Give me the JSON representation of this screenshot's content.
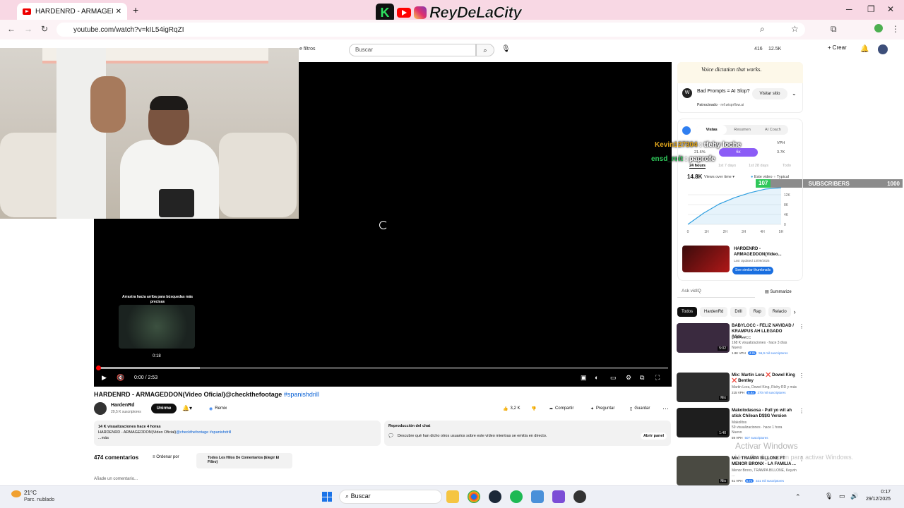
{
  "browser": {
    "tab_title": "HARDENRD - ARMAGEDDON(Vi",
    "url": "youtube.com/watch?v=kIL54igRqZI"
  },
  "overlay": {
    "k_letter": "K",
    "brand": "ReyDeLaCity",
    "chat": [
      {
        "user": "Kevin127304",
        "message": ": tfehy loche"
      },
      {
        "user": "ensd_roit",
        "message": ": paprofe"
      }
    ],
    "subs_label": "SUBSCRIBERS",
    "subs_count": "107",
    "subs_goal": "1000"
  },
  "youtube_header": {
    "filters_label": "e filtros",
    "search_placeholder": "Buscar",
    "stat_a": "416",
    "stat_b": "12.5K",
    "create_label": "Crear"
  },
  "player": {
    "hint": "Arrastra hacia arriba para búsquedas más precisas",
    "preview_time": "0:18",
    "current_time": "0:00 / 2:53",
    "progress_played": 0.003,
    "progress_buffered": 0.18
  },
  "video": {
    "title": "HARDENRD - ARMAGEDDON(Video Oficial)@checkthefootage",
    "hashtag": "#spanishdrill",
    "channel": "HardenRd",
    "channel_subs": "29,5 K suscriptores",
    "join_label": "Unirme",
    "remix_label": "Remix",
    "likes": "3,2 K",
    "share_label": "Compartir",
    "ask_label": "Preguntar",
    "save_label": "Guardar",
    "views_line": "14 K visualizaciones  hace 4 horas",
    "desc_line": "HARDENRD - ARMAGEDDON(Video Oficial)",
    "desc_link": "@checkthefootage #spanishdrill",
    "more": "...más",
    "chat_replay_title": "Reproducción del chat",
    "chat_replay_desc": "Descubre qué han dicho otros usuarios sobre este vídeo mientras se emitía en directo.",
    "open_panel": "Abrir panel",
    "comments_count": "474 comentarios",
    "sort_label": "Ordenar por",
    "threads_label": "Todos Los Hilos De Comentarios (Elegir El Filtro)",
    "add_comment": "Añade un comentario..."
  },
  "ad": {
    "banner": "Voice dictation that works.",
    "title": "Bad Prompts = AI Slop?",
    "sponsored": "Patrocinado",
    "sponsor_url": "ref.wisprflow.ai",
    "visit_label": "Visitar sitio"
  },
  "vidiq": {
    "tabs": [
      "Vistas",
      "Resumen",
      "AI Coach"
    ],
    "vph_label": "VPH",
    "pct": "21.6%",
    "pill": "6x",
    "vph_value": "3.7K",
    "periods": [
      "24 hours",
      "1st 7 days",
      "1st 28 days",
      "Todo"
    ],
    "views": "14.8K",
    "views_over_time": "Views over time",
    "legend_this": "Este video",
    "legend_typical": "Typical",
    "chart_data": {
      "type": "line",
      "x": [
        "0",
        "1H",
        "2H",
        "3H",
        "4H",
        "5H"
      ],
      "y_ticks": [
        "0",
        "4K",
        "8K",
        "12K"
      ],
      "series": [
        {
          "name": "Este video",
          "values": [
            0,
            4500,
            8200,
            10800,
            12800,
            14300,
            14800
          ]
        }
      ]
    },
    "related_title": "HARDENRD - ARMAGEDDON(Video...",
    "related_sub": "Last Updated 13/09/2025",
    "related_btn": "See similar thumbnails",
    "ask_placeholder": "Ask vidIQ",
    "summarize": "Summarize"
  },
  "chips": [
    "Todos",
    "HardenRd",
    "Drill",
    "Rap",
    "Relacio"
  ],
  "recommendations": [
    {
      "title": "BABYLOCC - FELIZ NAVIDAD / KRAMPUS AH LLEGADO (Vide...",
      "channel": "BABYLOCC",
      "meta": "168 K visualizaciones · hace 3 días",
      "badge": "Nuevo",
      "vph": "1.8K VPH",
      "mult": "4.2x",
      "subs": "56,9 mil suscriptores",
      "duration": "5:02",
      "color": "#3a2a3f"
    },
    {
      "title": "Mix: Martin Lora ❌ Dowel King ❌ Bentley",
      "channel": "",
      "meta": "Martin Lora, Dowel King, Richy RD y más",
      "badge": "",
      "vph": "215 VPH",
      "mult": "5.9x",
      "subs": "270 mil suscriptores",
      "duration": "Mix",
      "color": "#2d2d2d"
    },
    {
      "title": "Makolodasosa - Pull yo wit ah stick Chilean D$$G Version",
      "channel": "Makolitos",
      "meta": "59 visualizaciones · hace 1 hora",
      "badge": "Nuevo",
      "vph": "59 VPH",
      "mult": "",
      "subs": "507 suscriptores",
      "duration": "1:40",
      "color": "#1e1e1e"
    },
    {
      "title": "Mix: TRAMPA BILLONE FT MENOR BRONX - LA FAMILIA ...",
      "channel": "",
      "meta": "Menor Bronx, TRAMPA BILLONE, Keyvin ...",
      "badge": "",
      "vph": "61 VPH",
      "mult": "8.7x",
      "subs": "321 mil suscriptores",
      "duration": "Mix",
      "color": "#4a4a42"
    }
  ],
  "watermark": {
    "title": "Activar Windows",
    "sub": "Ve a Configuración para activar Windows."
  },
  "taskbar": {
    "temp": "21°C",
    "condition": "Parc. nublado",
    "search": "Buscar",
    "time": "0:17",
    "date": "29/12/2025"
  }
}
